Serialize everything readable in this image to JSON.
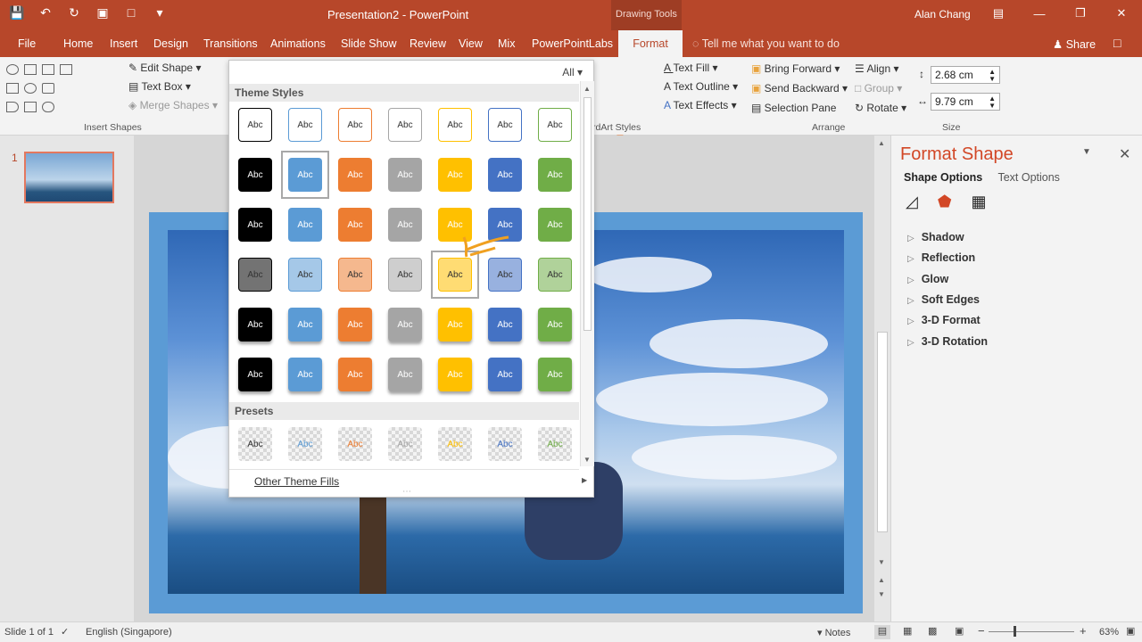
{
  "titlebar": {
    "document_title": "Presentation2  -  PowerPoint",
    "contextual_group": "Drawing Tools",
    "user": "Alan Chang",
    "qat_icons": [
      "save-icon",
      "undo-icon",
      "dropdown-arrow-icon",
      "redo-icon",
      "present-icon",
      "touch-mode-icon",
      "customize-qat-icon"
    ],
    "window_icons": [
      "ribbon-display-icon",
      "minimize-icon",
      "restore-icon",
      "close-icon"
    ]
  },
  "tabs": {
    "items": [
      "File",
      "Home",
      "Insert",
      "Design",
      "Transitions",
      "Animations",
      "Slide Show",
      "Review",
      "View",
      "Mix",
      "PowerPointLabs"
    ],
    "active": "Format",
    "tell_me": "Tell me what you want to do",
    "share": "Share"
  },
  "ribbon": {
    "insert_shapes": {
      "edit_shape": "Edit Shape",
      "text_box": "Text Box",
      "merge_shapes": "Merge Shapes",
      "label": "Insert Shapes"
    },
    "wordart": {
      "text_fill": "Text Fill",
      "text_outline": "Text Outline",
      "text_effects": "Text Effects",
      "label": "rdArt Styles",
      "big_letter": "A"
    },
    "arrange": {
      "bring_forward": "Bring Forward",
      "send_backward": "Send Backward",
      "selection_pane": "Selection Pane",
      "align": "Align",
      "group": "Group",
      "rotate": "Rotate",
      "label": "Arrange"
    },
    "size": {
      "height": "2.68 cm",
      "width": "9.79 cm",
      "label": "Size"
    }
  },
  "thumbnails": {
    "slide_number": "1"
  },
  "gallery": {
    "filter": "All",
    "theme_styles_header": "Theme Styles",
    "presets_header": "Presets",
    "cell_text": "Abc",
    "other_fills": "Other Theme Fills",
    "palette": [
      "#000000",
      "#5b9bd5",
      "#ed7d31",
      "#a5a5a5",
      "#ffc000",
      "#4472c4",
      "#70ad47"
    ]
  },
  "format_pane": {
    "title": "Format Shape",
    "tab_shape": "Shape Options",
    "tab_text": "Text Options",
    "sections": [
      "Shadow",
      "Reflection",
      "Glow",
      "Soft Edges",
      "3-D Format",
      "3-D Rotation"
    ]
  },
  "statusbar": {
    "slide_info": "Slide 1 of 1",
    "language": "English (Singapore)",
    "notes": "Notes",
    "zoom": "63%"
  }
}
